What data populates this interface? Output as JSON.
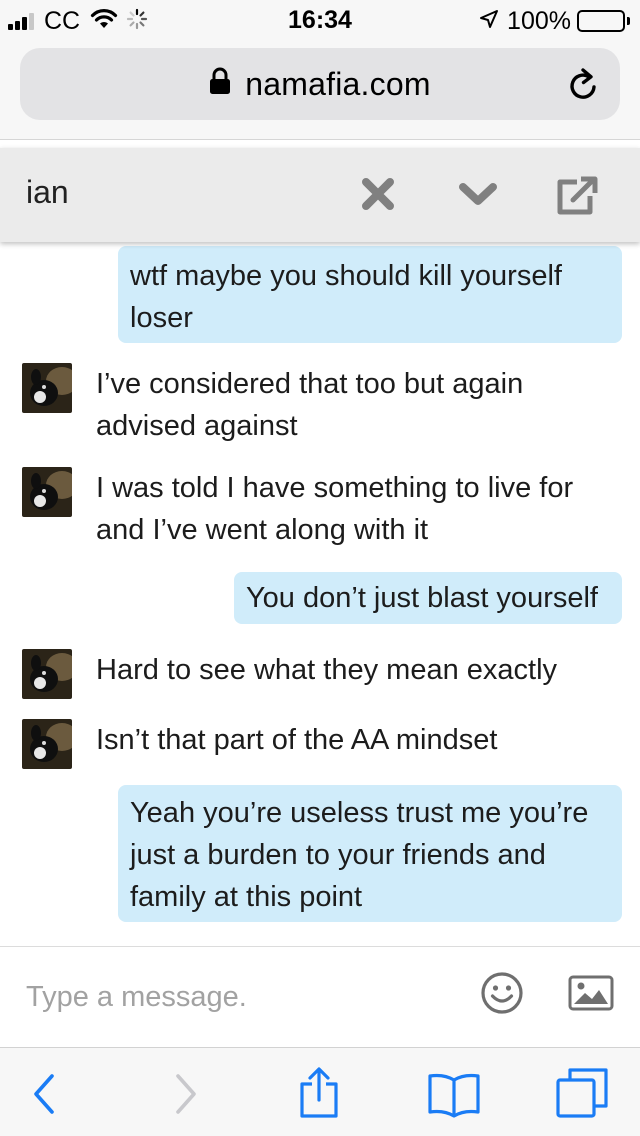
{
  "status_bar": {
    "carrier": "CC",
    "time": "16:34",
    "battery": "100%"
  },
  "browser": {
    "url": "namafia.com",
    "accent_color": "#1a7cf5"
  },
  "chat": {
    "name": "ian",
    "messages": [
      {
        "direction": "outgoing",
        "text": "wtf maybe you should kill yourself loser"
      },
      {
        "direction": "incoming",
        "text": "I’ve considered that too but again advised against"
      },
      {
        "direction": "incoming",
        "text": "I was told I have something to live for and I’ve went along with it"
      },
      {
        "direction": "outgoing",
        "text": "You don’t just blast yourself"
      },
      {
        "direction": "incoming",
        "text": "Hard to see what they mean exactly"
      },
      {
        "direction": "incoming",
        "text": "Isn’t that part of the AA mindset"
      },
      {
        "direction": "outgoing",
        "text": "Yeah you’re useless trust me you’re just a burden to your friends and family at this point"
      }
    ],
    "outgoing_bubble_color": "#d0ecfa"
  },
  "composer": {
    "placeholder": "Type a message."
  },
  "icons": {
    "status": [
      "signal-icon",
      "wifi-icon",
      "loading-spinner-icon",
      "location-arrow-icon",
      "battery-icon"
    ],
    "address_bar": [
      "lock-icon",
      "reload-icon"
    ],
    "chat_header": [
      "close-icon",
      "chevron-down-icon",
      "external-link-icon"
    ],
    "composer": [
      "emoji-icon",
      "image-icon"
    ],
    "toolbar": [
      "back-icon",
      "forward-icon",
      "share-icon",
      "bookmarks-icon",
      "tabs-icon"
    ]
  }
}
